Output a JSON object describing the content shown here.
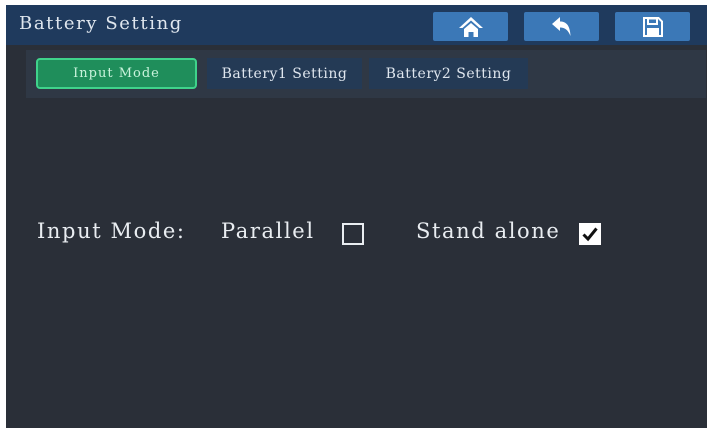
{
  "header": {
    "title": "Battery Setting",
    "buttons": [
      {
        "name": "home",
        "icon": "home-icon"
      },
      {
        "name": "back",
        "icon": "back-arrow-icon"
      },
      {
        "name": "save",
        "icon": "save-icon"
      }
    ]
  },
  "tabs": [
    {
      "label": "Input Mode",
      "active": true
    },
    {
      "label": "Battery1 Setting",
      "active": false
    },
    {
      "label": "Battery2 Setting",
      "active": false
    }
  ],
  "input_mode": {
    "label": "Input Mode:",
    "options": [
      {
        "label": "Parallel",
        "checked": false
      },
      {
        "label": "Stand alone",
        "checked": true
      }
    ]
  },
  "colors": {
    "background": "#2a2f38",
    "titlebar": "#1f3a5d",
    "button": "#3b78b7",
    "active_tab": "#1f8e5b",
    "active_tab_border": "#3fd38b",
    "inactive_tab": "#243a55"
  }
}
